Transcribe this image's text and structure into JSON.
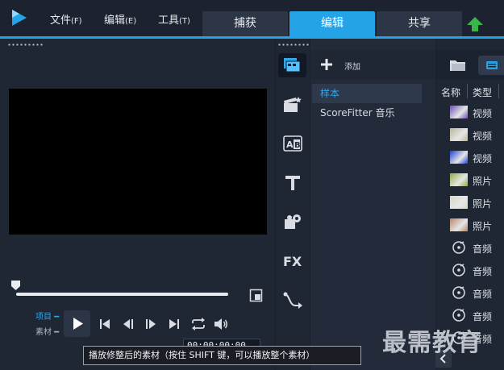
{
  "menu": [
    {
      "label": "文件",
      "accel": "(F)"
    },
    {
      "label": "编辑",
      "accel": "(E)"
    },
    {
      "label": "工具",
      "accel": "(T)"
    }
  ],
  "tabs": [
    "捕获",
    "编辑",
    "共享"
  ],
  "active_tab": "编辑",
  "player": {
    "mode_project": "项目",
    "mode_clip": "素材",
    "timecode": "00:00:00:00",
    "tooltip": "播放修整后的素材（按住 SHIFT 键，可以播放整个素材）",
    "screen_color": "#000000"
  },
  "rail_icons": [
    "media-library-icon",
    "instant-project-icon",
    "title-template-icon",
    "text-icon",
    "filter-icon",
    "fx-icon",
    "transition-path-icon"
  ],
  "rail_fx_label": "FX",
  "library": {
    "add_label": "添加",
    "items": [
      "样本",
      "ScoreFitter 音乐"
    ],
    "selected": 0
  },
  "media": {
    "col_name": "名称",
    "col_type": "类型",
    "rows": [
      {
        "type": "视频",
        "thumb": "video"
      },
      {
        "type": "视频",
        "thumb": "video"
      },
      {
        "type": "视频",
        "thumb": "video"
      },
      {
        "type": "照片",
        "thumb": "photo"
      },
      {
        "type": "照片",
        "thumb": "photo"
      },
      {
        "type": "照片",
        "thumb": "photo"
      },
      {
        "type": "音频",
        "thumb": "audio"
      },
      {
        "type": "音频",
        "thumb": "audio"
      },
      {
        "type": "音频",
        "thumb": "audio"
      },
      {
        "type": "音频",
        "thumb": "audio"
      },
      {
        "type": "音频",
        "thumb": "audio"
      }
    ]
  },
  "watermark": "最需教育",
  "colors": {
    "accent": "#24a4e6",
    "bg": "#1b2230",
    "upload_arrow": "#39b54a"
  }
}
